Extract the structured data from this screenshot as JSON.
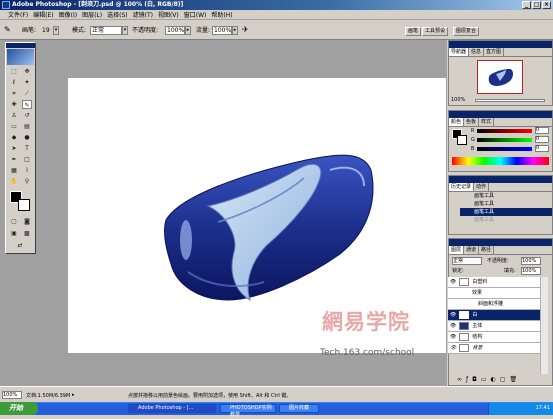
{
  "title": "Adobe Photoshop - [剃须刀.psd @ 100% (白, RGB/8)]",
  "menu": [
    "文件(F)",
    "编辑(E)",
    "图像(I)",
    "图层(L)",
    "选择(S)",
    "滤镜(T)",
    "视图(V)",
    "窗口(W)",
    "帮助(H)"
  ],
  "options": {
    "brush_label": "画笔:",
    "brush_size": "19",
    "mode_label": "模式:",
    "mode_value": "正常",
    "opacity_label": "不透明度:",
    "opacity_value": "100%",
    "flow_label": "流量:",
    "flow_value": "100%",
    "dock_tabs": [
      "画笔",
      "工具预设",
      "图层复合"
    ]
  },
  "navigator": {
    "tabs": [
      "导航器",
      "信息",
      "直方图"
    ],
    "zoom": "100%"
  },
  "color_panel": {
    "tabs": [
      "颜色",
      "色板",
      "样式"
    ],
    "channels": [
      "R",
      "G",
      "B"
    ],
    "values": [
      "0",
      "0",
      "0"
    ]
  },
  "history": {
    "tabs": [
      "历史记录",
      "动作"
    ],
    "items": [
      "画笔工具",
      "画笔工具",
      "画笔工具",
      "画笔工具"
    ]
  },
  "layers": {
    "tabs": [
      "图层",
      "通道",
      "路径"
    ],
    "mode": "正常",
    "opacity_label": "不透明度:",
    "opacity_value": "100%",
    "lock_label": "锁定:",
    "fill_label": "填充:",
    "fill_value": "100%",
    "items": [
      {
        "name": "白塑料",
        "selected": false
      },
      {
        "name": "效果",
        "selected": false
      },
      {
        "name": "斜面和浮雕",
        "selected": false
      },
      {
        "name": "白",
        "selected": true
      },
      {
        "name": "主体",
        "selected": false
      },
      {
        "name": "结构",
        "selected": false
      },
      {
        "name": "背景",
        "selected": false
      }
    ]
  },
  "status": {
    "zoom": "100%",
    "doc": "文档:1.50M/6.39M",
    "hint": "点按并拖移以用前景色绘画。要用附加选项，使用 Shift、Alt 和 Ctrl 键。"
  },
  "taskbar": {
    "start": "开始",
    "items": [
      "Adobe Photoshop - [...",
      "PHOTOSHOP实例教学",
      "图片收藏"
    ],
    "clock": "17:41"
  },
  "watermark": {
    "logo_text": "網易学院",
    "url": "Tech.163.com/school"
  },
  "colors": {
    "accent": "#0a246a",
    "product": "#1c2f8c",
    "highlight": "#a9c6e8"
  }
}
